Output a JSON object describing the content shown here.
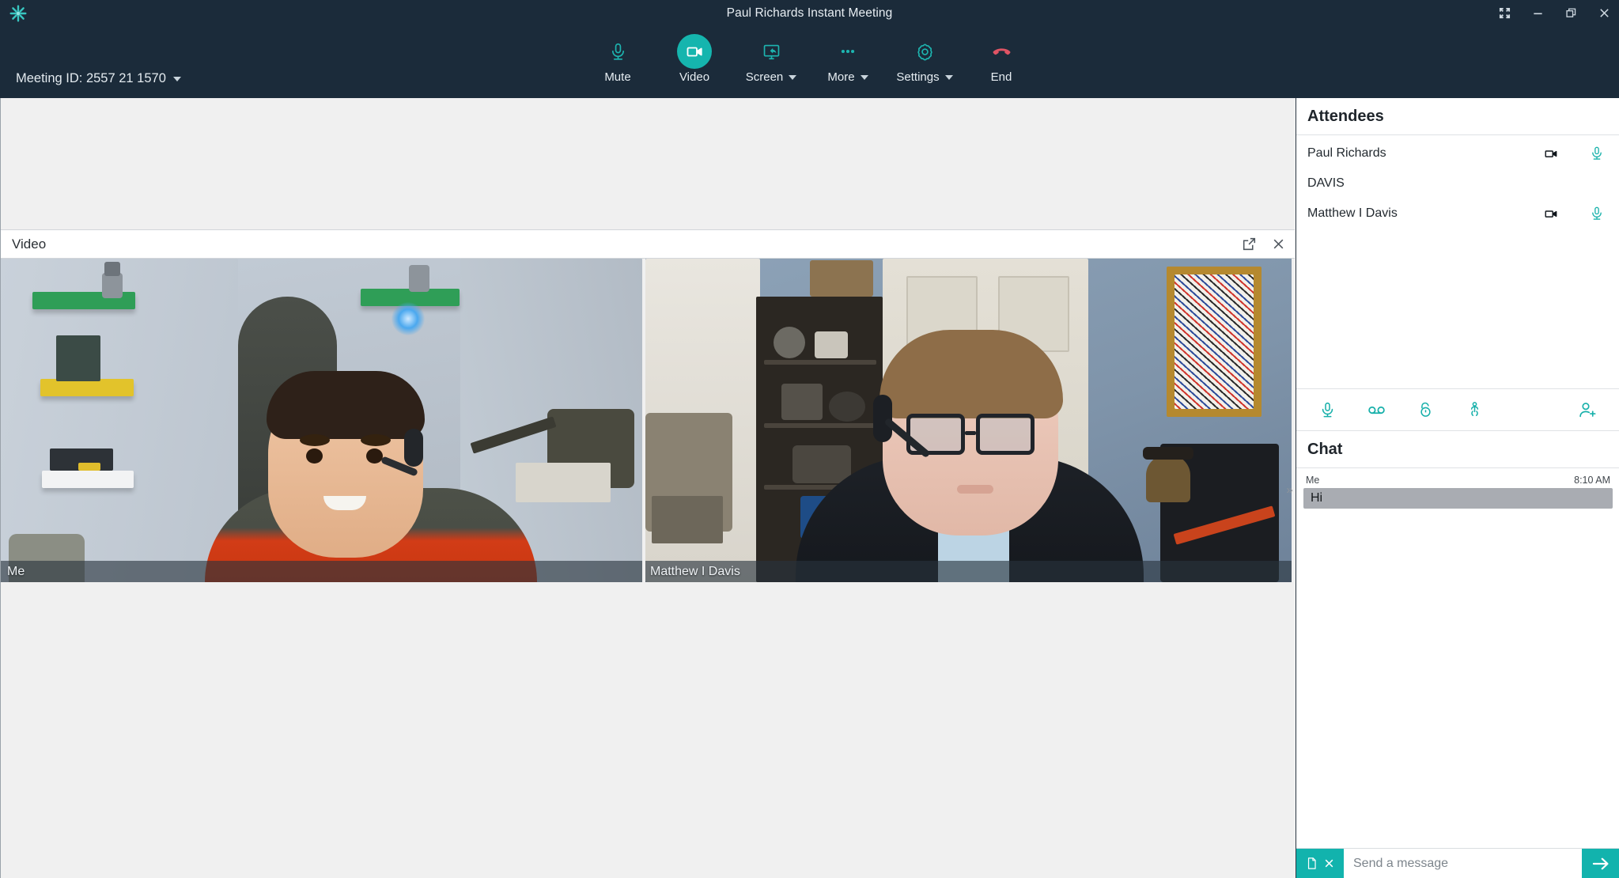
{
  "window": {
    "title": "Paul Richards Instant Meeting",
    "logo_icon": "teal-asterisk-logo",
    "controls": [
      {
        "name": "fullscreen",
        "icon": "fullscreen-icon"
      },
      {
        "name": "minimize",
        "icon": "minimize-icon"
      },
      {
        "name": "restore",
        "icon": "restore-icon"
      },
      {
        "name": "close",
        "icon": "close-icon"
      }
    ]
  },
  "toolbar": {
    "meeting_id_label": "Meeting ID: 2557 21 1570",
    "buttons": [
      {
        "label": "Mute",
        "icon": "microphone-icon",
        "active": false,
        "caret": false
      },
      {
        "label": "Video",
        "icon": "video-camera-icon",
        "active": true,
        "caret": false
      },
      {
        "label": "Screen",
        "icon": "screen-share-icon",
        "active": false,
        "caret": true
      },
      {
        "label": "More",
        "icon": "ellipsis-icon",
        "active": false,
        "caret": true
      },
      {
        "label": "Settings",
        "icon": "gear-icon",
        "active": false,
        "caret": true
      },
      {
        "label": "End",
        "icon": "end-call-icon",
        "active": false,
        "caret": false
      }
    ]
  },
  "video_panel": {
    "title": "Video",
    "popout_icon": "pop-out-icon",
    "close_icon": "close-icon",
    "tiles": [
      {
        "label": "Me"
      },
      {
        "label": "Matthew I Davis"
      }
    ]
  },
  "sidebar": {
    "collapse_icon": "double-chevron-right-icon",
    "attendees": {
      "heading": "Attendees",
      "rows": [
        {
          "name": "Paul Richards",
          "camera": true,
          "mic": true
        },
        {
          "name": "DAVIS",
          "camera": false,
          "mic": false
        },
        {
          "name": "Matthew I Davis",
          "camera": true,
          "mic": true
        }
      ],
      "tools": [
        {
          "name": "mute-all",
          "icon": "microphone-icon"
        },
        {
          "name": "record",
          "icon": "voicemail-icon"
        },
        {
          "name": "lock-meeting",
          "icon": "unlocked-padlock-icon"
        },
        {
          "name": "raise-hand",
          "icon": "raise-hand-icon"
        },
        {
          "name": "invite-attendee",
          "icon": "add-person-icon"
        }
      ]
    },
    "chat": {
      "heading": "Chat",
      "messages": [
        {
          "author": "Me",
          "time": "8:10 AM",
          "text": "Hi"
        }
      ],
      "composer": {
        "placeholder": "Send a message",
        "file_icon": "file-icon",
        "clear_icon": "close-icon",
        "send_icon": "arrow-right-icon"
      }
    }
  },
  "colors": {
    "header_bg": "#1b2b3a",
    "accent_teal": "#15b5ae",
    "end_red": "#e05464",
    "stage_bg": "#f0f0f0",
    "bubble_gray": "#a9acb2"
  }
}
